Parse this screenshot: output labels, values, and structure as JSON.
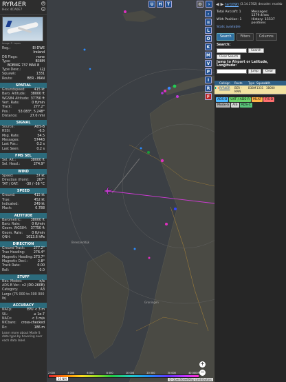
{
  "aircraft": {
    "callsign": "RYR4ER",
    "hex_label": "Hex: 4CA0E7",
    "photo_credit": "Image © Lopes",
    "registration": "EI-DWE",
    "country": "Ireland",
    "db_flags": "none",
    "type": "B38M",
    "type_full": "BOEING 737 MAX 8",
    "type_desc": "L2J",
    "squawk": "1331",
    "route": "BER - MAN"
  },
  "sections": {
    "spatial": "SPATIAL",
    "signal": "SIGNAL",
    "fms": "FMS SEL",
    "wind": "WIND",
    "speed": "SPEED",
    "altitude": "ALTITUDE",
    "direction": "DIRECTION",
    "stuff": "STUFF",
    "accuracy": "ACCURACY"
  },
  "labels": {
    "reg": "Reg.:",
    "db_flags": "DB Flags:",
    "type": "Type:",
    "type_desc": "Type Desc.:",
    "squawk": "Squawk:",
    "route": "Route:",
    "groundspeed": "Groundspeed:",
    "baro_alt": "Baro. Altitude:",
    "wgs84": "WGS84 Altitude:",
    "vert_rate": "Vert. Rate:",
    "track": "Track:",
    "pos": "Pos.:",
    "distance": "Distance:",
    "source": "Source:",
    "rssi": "RSSI:",
    "msg_rate": "Msg. Rate:",
    "messages": "Messages:",
    "last_pos": "Last Pos.:",
    "last_seen": "Last Seen:",
    "sel_alt": "Sel. Alt.:",
    "sel_head": "Sel. Head.:",
    "wind_speed": "Speed:",
    "wind_dir": "Direction (from):",
    "tat_oat": "TAT / OAT:",
    "ground": "Ground:",
    "true": "True:",
    "indicated": "Indicated:",
    "mach": "Mach:",
    "barometric": "Barometric:",
    "baro_rate": "Baro. Rate:",
    "geom_wgs84": "Geom. WGS84:",
    "geom_rate": "Geom. Rate:",
    "qnh": "QNH:",
    "ground_track": "Ground Track:",
    "true_heading": "True Heading:",
    "mag_heading": "Magnetic Heading:",
    "mag_decl": "Magnetic Decl.:",
    "track_rate": "Track Rate:",
    "roll": "Roll:",
    "nav_modes": "Nav. Modes:",
    "adsb_ver": "ADS-B Ver.:",
    "category": "Category:",
    "nacp": "NACp:",
    "sil": "SIL:",
    "nacv": "NACv:",
    "nic_baro": "NICbaro:",
    "rc": "Rc:"
  },
  "spatial": {
    "groundspeed": "415 kt",
    "baro_alt": "38000 ft",
    "wgs84": "37750 ft",
    "vert_rate": "0 ft/min",
    "track": "277.2°",
    "pos": "53.083°, 5.248°",
    "distance": "27.0 nmi"
  },
  "signal": {
    "source": "ADS-B",
    "rssi": "-6.5",
    "msg_rate": "54.5",
    "messages": "57443",
    "last_pos": "0.2 s",
    "last_seen": "0.2 s"
  },
  "fms": {
    "sel_alt": "38000 ft",
    "sel_head": "274.9°"
  },
  "wind": {
    "speed": "37 kt",
    "dir": "267°",
    "tat_oat": "-30 / -56 °C"
  },
  "speed": {
    "ground": "415 kt",
    "true": "452 kt",
    "indicated": "249 kt",
    "mach": "0.788"
  },
  "altitude": {
    "barometric": "38000 ft",
    "baro_rate": "0 ft/min",
    "geom_wgs84": "37750 ft",
    "geom_rate": "0 ft/min",
    "qnh": "1013.6 hPa"
  },
  "direction": {
    "ground_track": "277.2°",
    "true_heading": "276.4°",
    "mag_heading": "273.7°",
    "mag_decl": "2.8°",
    "track_rate": "0.00",
    "roll": "0.0"
  },
  "stuff": {
    "nav_modes": "n/a",
    "adsb_ver": "v2 (DO-260B)",
    "category": "A3",
    "category_desc": "Large (75 000 to 300 000 lb)"
  },
  "accuracy": {
    "nacp": "EPU < 3 m",
    "sil": "≤ 1e-7",
    "nacv": "< 3 m/s",
    "nic_baro": "cross-checked",
    "rc": "186 m"
  },
  "info_note": "Learn more about Mode S data type by hovering over each data label.",
  "map": {
    "top_buttons": [
      "U",
      "H",
      "T"
    ],
    "side_buttons": [
      "L",
      "O",
      "K",
      "M",
      "V",
      "P",
      "I",
      "R",
      "F"
    ],
    "city_label": "Groningen",
    "town_label": "Breezanddijk",
    "legend_labels": [
      "2 000",
      "4 000",
      "6 000",
      "8 000",
      "10 000",
      "20 000",
      "30 000",
      "40 000 ft"
    ],
    "scale_label": "10 NM",
    "osm_credit": "© OpenStreetMap contributors",
    "zoom_in": "+",
    "zoom_out": "−"
  },
  "right_panel": {
    "link": "tar1090",
    "version": "(3.14.1782) decoder: readsb",
    "total_aircraft": "Total Aircraft: 1",
    "with_position": "With Position: 1",
    "messages": "Messages: 1279.4/sec",
    "history": "History: 15537 positions",
    "stats": "Stats available",
    "tabs": [
      "Search",
      "Filters",
      "Columns"
    ],
    "search_label": "Search:",
    "search_button": "Search",
    "clear_search": "Clear Search",
    "jump_label": "Jump to Airport or Latitude, Longitude:",
    "jump_button": "Jump",
    "clear_button": "Clear",
    "table_headers": [
      "",
      "Callsign",
      "Route",
      "Type",
      "Squawk",
      "Alt.",
      ""
    ],
    "table_row": [
      "IE",
      "RYR4ER",
      "BER - MAN",
      "B38M",
      "1331",
      "38000",
      ""
    ],
    "sources": [
      {
        "label": "ADS-B",
        "color": "#4db8ff"
      },
      {
        "label": "UAT / ADS-R",
        "color": "#6bd56b"
      },
      {
        "label": "MLAT",
        "color": "#ffb347"
      },
      {
        "label": "TIS-B",
        "color": "#ff6e6e"
      },
      {
        "label": "Mode-S",
        "color": "#b0b0b0"
      },
      {
        "label": "AIS",
        "color": "#d7d7d7"
      },
      {
        "label": "ADS-C",
        "color": "#59c47a"
      }
    ]
  }
}
